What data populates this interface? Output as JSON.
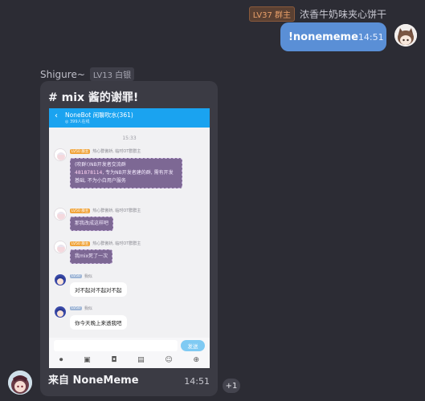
{
  "self_message": {
    "level_badge": "LV37 群主",
    "sender_name": "浓香牛奶味夹心饼干",
    "text": "!nonememe",
    "time": "14:51"
  },
  "other_message": {
    "sender_name": "Shigure~",
    "level_badge": "LV13 白银",
    "card_title": "# mix 酱的谢罪!",
    "card_footer": "来自 NoneMeme",
    "time": "14:51",
    "reaction": "+1"
  },
  "embedded_chat": {
    "group_title": "NoneBot 闲聊吹水(361)",
    "group_subtitle": "◎ 399人在线",
    "timestamp": "15:33",
    "messages": [
      {
        "tag": "LV50 群主",
        "meta": "热心群傲娇, 临时OT群群主",
        "text_a": "(吹群!)NB开发者交流群",
        "text_num": "481878114",
        "text_b": ", 专为NB开发者建的群, 需有开发基础, 不为小白用户服务"
      },
      {
        "tag": "LV50 群主",
        "meta": "热心群傲娇, 临时OT群群主",
        "text": "那我改成这样吧"
      },
      {
        "tag": "LV50 群主",
        "meta": "热心群傲娇, 临时OT群群主",
        "text": "我mix死了一次"
      },
      {
        "tag": "LV50",
        "meta": "我似",
        "text": "对不起对不起对不起"
      },
      {
        "tag": "LV50",
        "meta": "我似",
        "text": "你今天晚上来透我吧"
      }
    ],
    "send_label": "发送"
  }
}
